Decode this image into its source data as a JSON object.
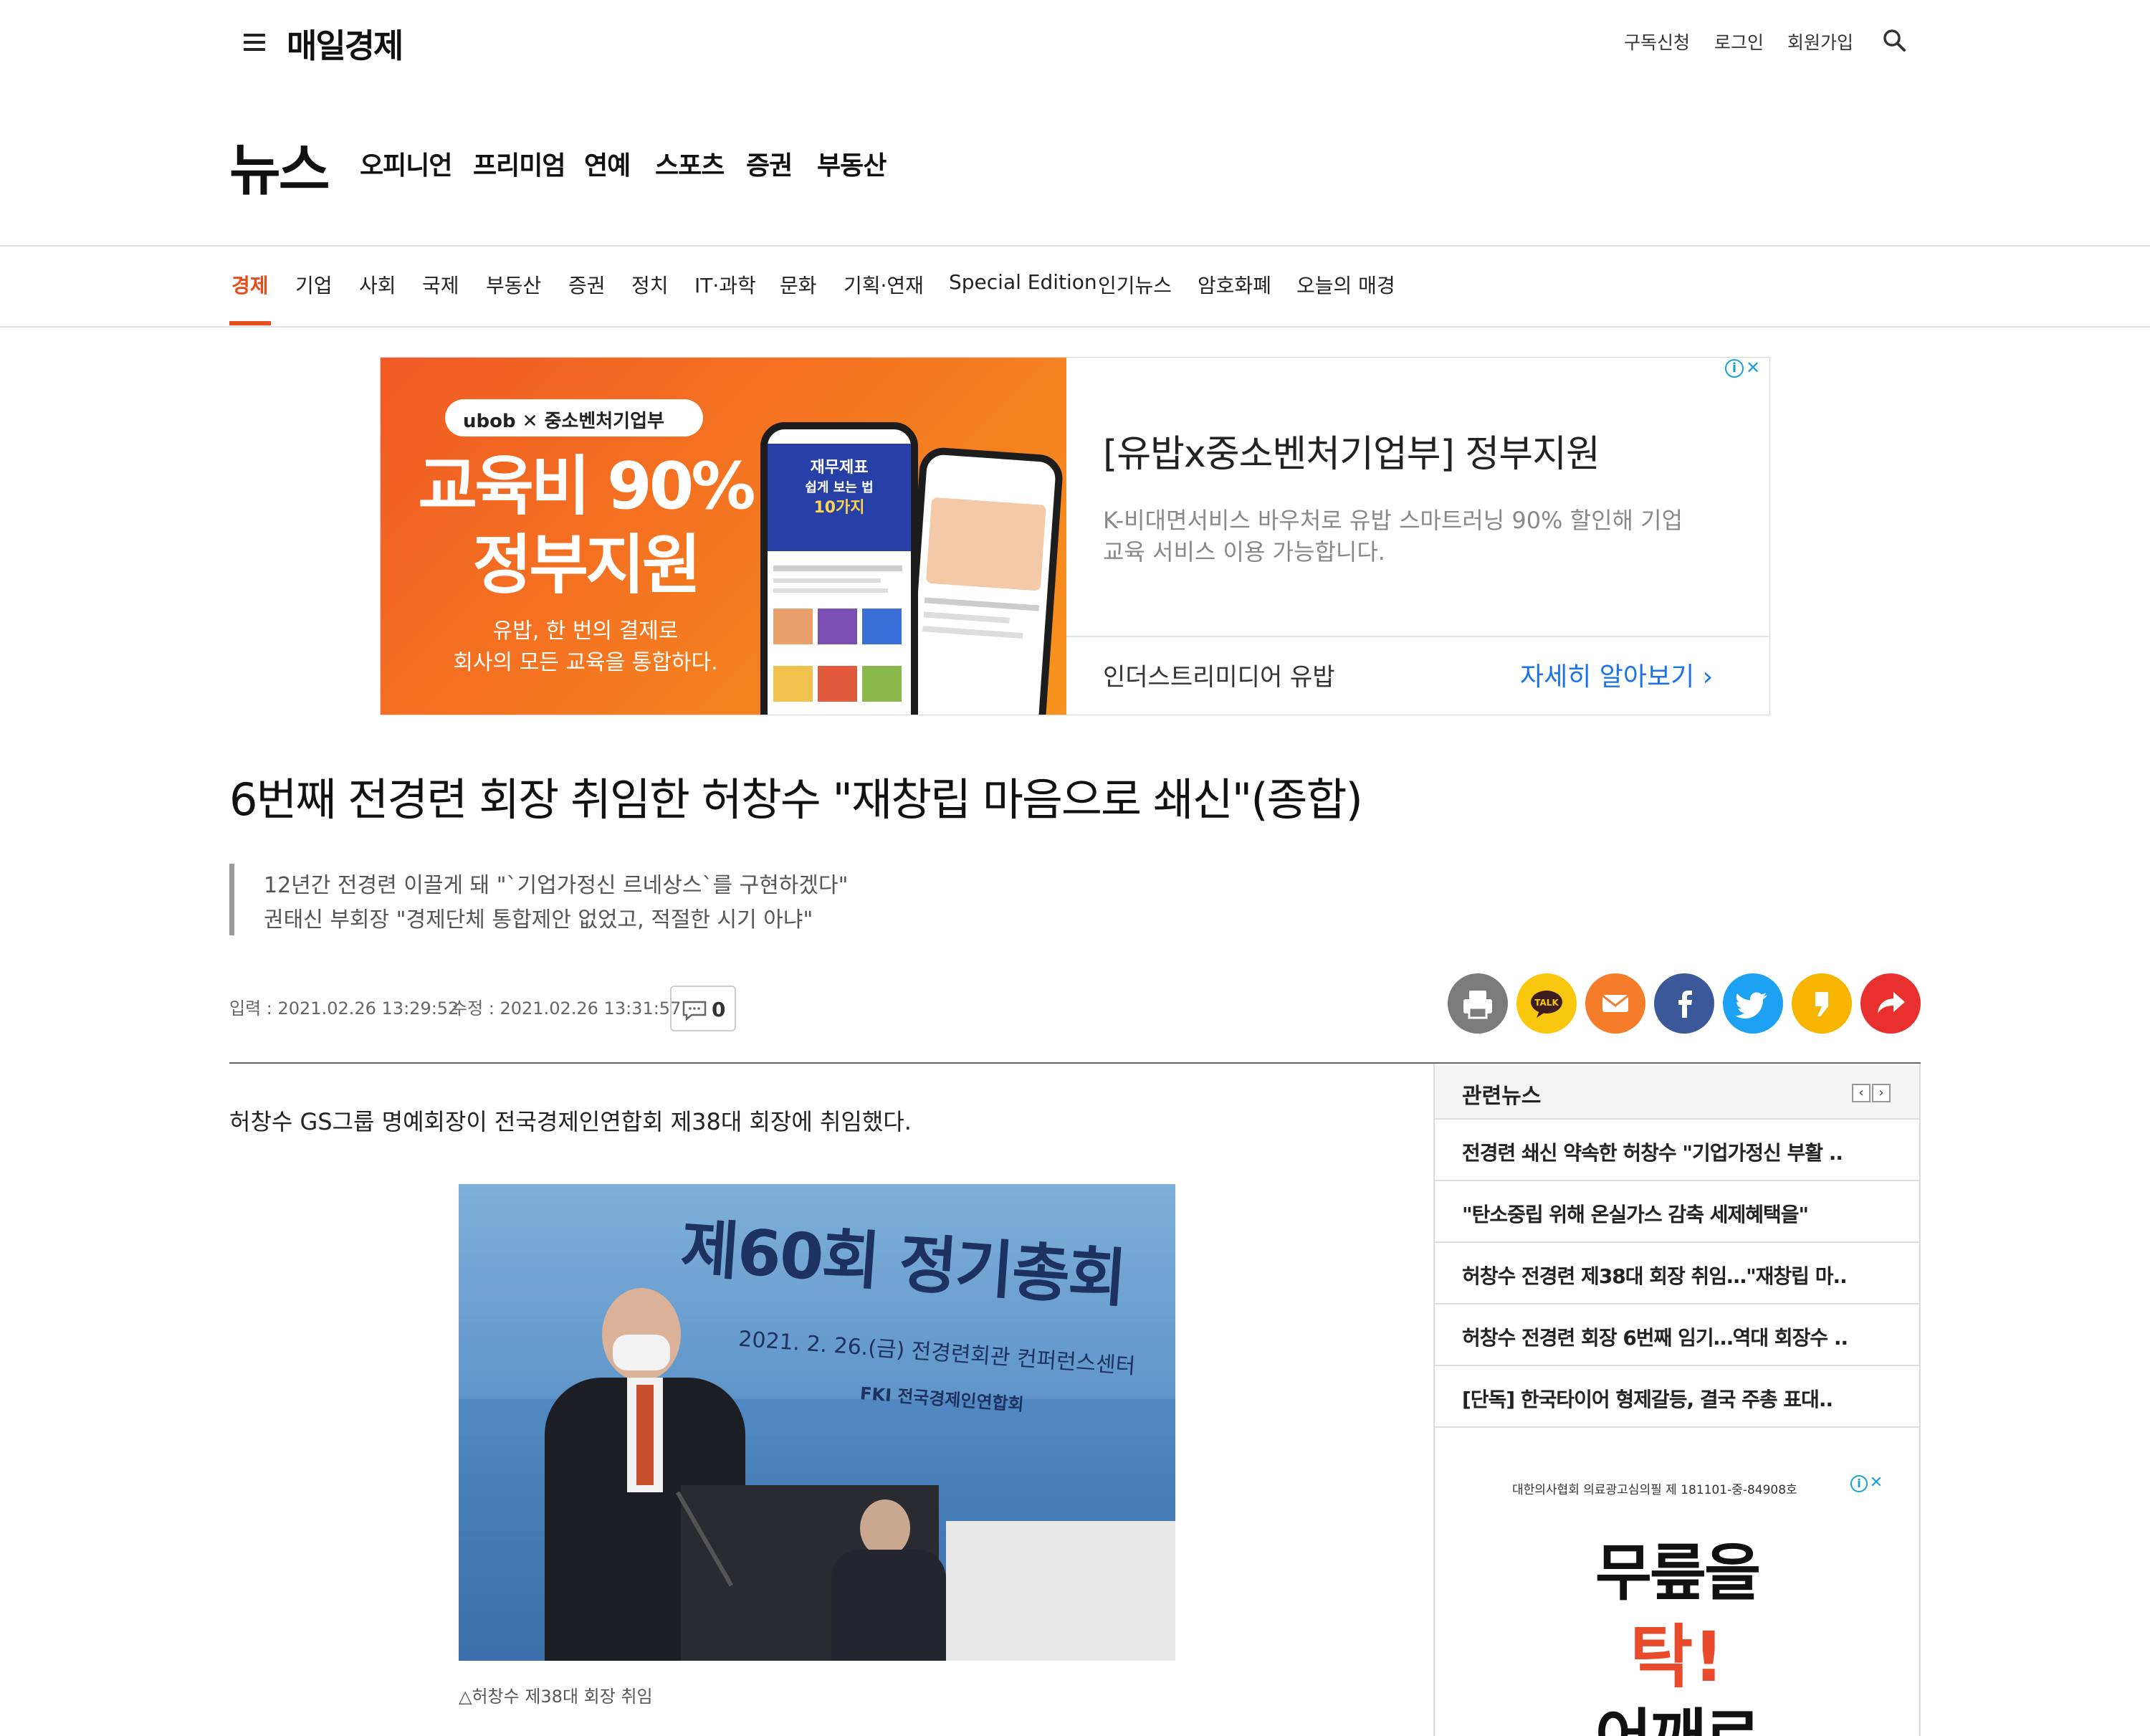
{
  "header": {
    "logo": "매일경제",
    "utility_links": [
      "구독신청",
      "로그인",
      "회원가입"
    ]
  },
  "section_nav": {
    "title": "뉴스",
    "links": [
      "오피니언",
      "프리미엄",
      "연예",
      "스포츠",
      "증권",
      "부동산"
    ]
  },
  "categories": {
    "items": [
      "경제",
      "기업",
      "사회",
      "국제",
      "부동산",
      "증권",
      "정치",
      "IT·과학",
      "문화",
      "기획·연재",
      "Special Edition",
      "인기뉴스",
      "암호화폐",
      "오늘의 매경"
    ],
    "active": "경제"
  },
  "ad_banner": {
    "brand_pill": "ubob ✕ 중소벤처기업부",
    "big_line1": "교육비 90%",
    "big_line2": "정부지원",
    "sub_line1": "유밥, 한 번의 결제로",
    "sub_line2": "회사의 모든 교육을 통합하다.",
    "phone_title1": "재무제표",
    "phone_title2": "쉽게 보는 법",
    "phone_title3": "10가지",
    "headline": "[유밥x중소벤처기업부] 정부지원",
    "description": "K-비대면서비스 바우처로 유밥 스마트러닝 90% 할인해 기업교육 서비스 이용 가능합니다.",
    "advertiser": "인더스트리미디어 유밥",
    "cta": "자세히 알아보기 ›"
  },
  "article": {
    "headline": "6번째 전경련 회장 취임한 허창수 \"재창립 마음으로 쇄신\"(종합)",
    "summary_line1": "12년간 전경련 이끌게 돼 \"`기업가정신 르네상스`를 구현하겠다\"",
    "summary_line2": "권태신 부회장 \"경제단체 통합제안 없었고, 적절한 시기 아냐\"",
    "published": "입력 : 2021.02.26 13:29:52",
    "modified": "수정 : 2021.02.26 13:31:57",
    "comment_count": "0",
    "lead": "허창수 GS그룹 명예회장이 전국경제인연합회 제38대 회장에 취임했다.",
    "photo_banner_title": "제60회 정기총회",
    "photo_banner_date": "2021. 2. 26.(금) 전경련회관 컨퍼런스센터",
    "photo_banner_org": "FKI 전국경제인연합회",
    "caption": "△허창수 제38대 회장 취임"
  },
  "share": {
    "icons": [
      "print-icon",
      "kakaotalk-icon",
      "email-icon",
      "facebook-icon",
      "twitter-icon",
      "kakaostory-icon",
      "share-icon"
    ],
    "colors": [
      "#7b7b7b",
      "#f9c80e",
      "#f47c2a",
      "#3b5998",
      "#1da1f2",
      "#f7b500",
      "#e8302e"
    ],
    "talk_label": "TALK"
  },
  "related_news": {
    "title": "관련뉴스",
    "items": [
      "전경련 쇄신 약속한 허창수 \"기업가정신 부활 ..",
      "\"탄소중립 위해 온실가스 감축 세제혜택을\"",
      "허창수 전경련 제38대 회장 취임…\"재창립 마..",
      "허창수 전경련 회장 6번째 임기…역대 회장수 ..",
      "[단독] 한국타이어 형제갈등, 결국 주총 표대.."
    ]
  },
  "side_ad": {
    "notice": "대한의사협회 의료광고심의필 제 181101-중-84908호",
    "line1": "무릎을",
    "line2": "탁!",
    "line3": "어깨르"
  },
  "colors": {
    "accent": "#e74c1c",
    "link_blue": "#1a73e8"
  }
}
